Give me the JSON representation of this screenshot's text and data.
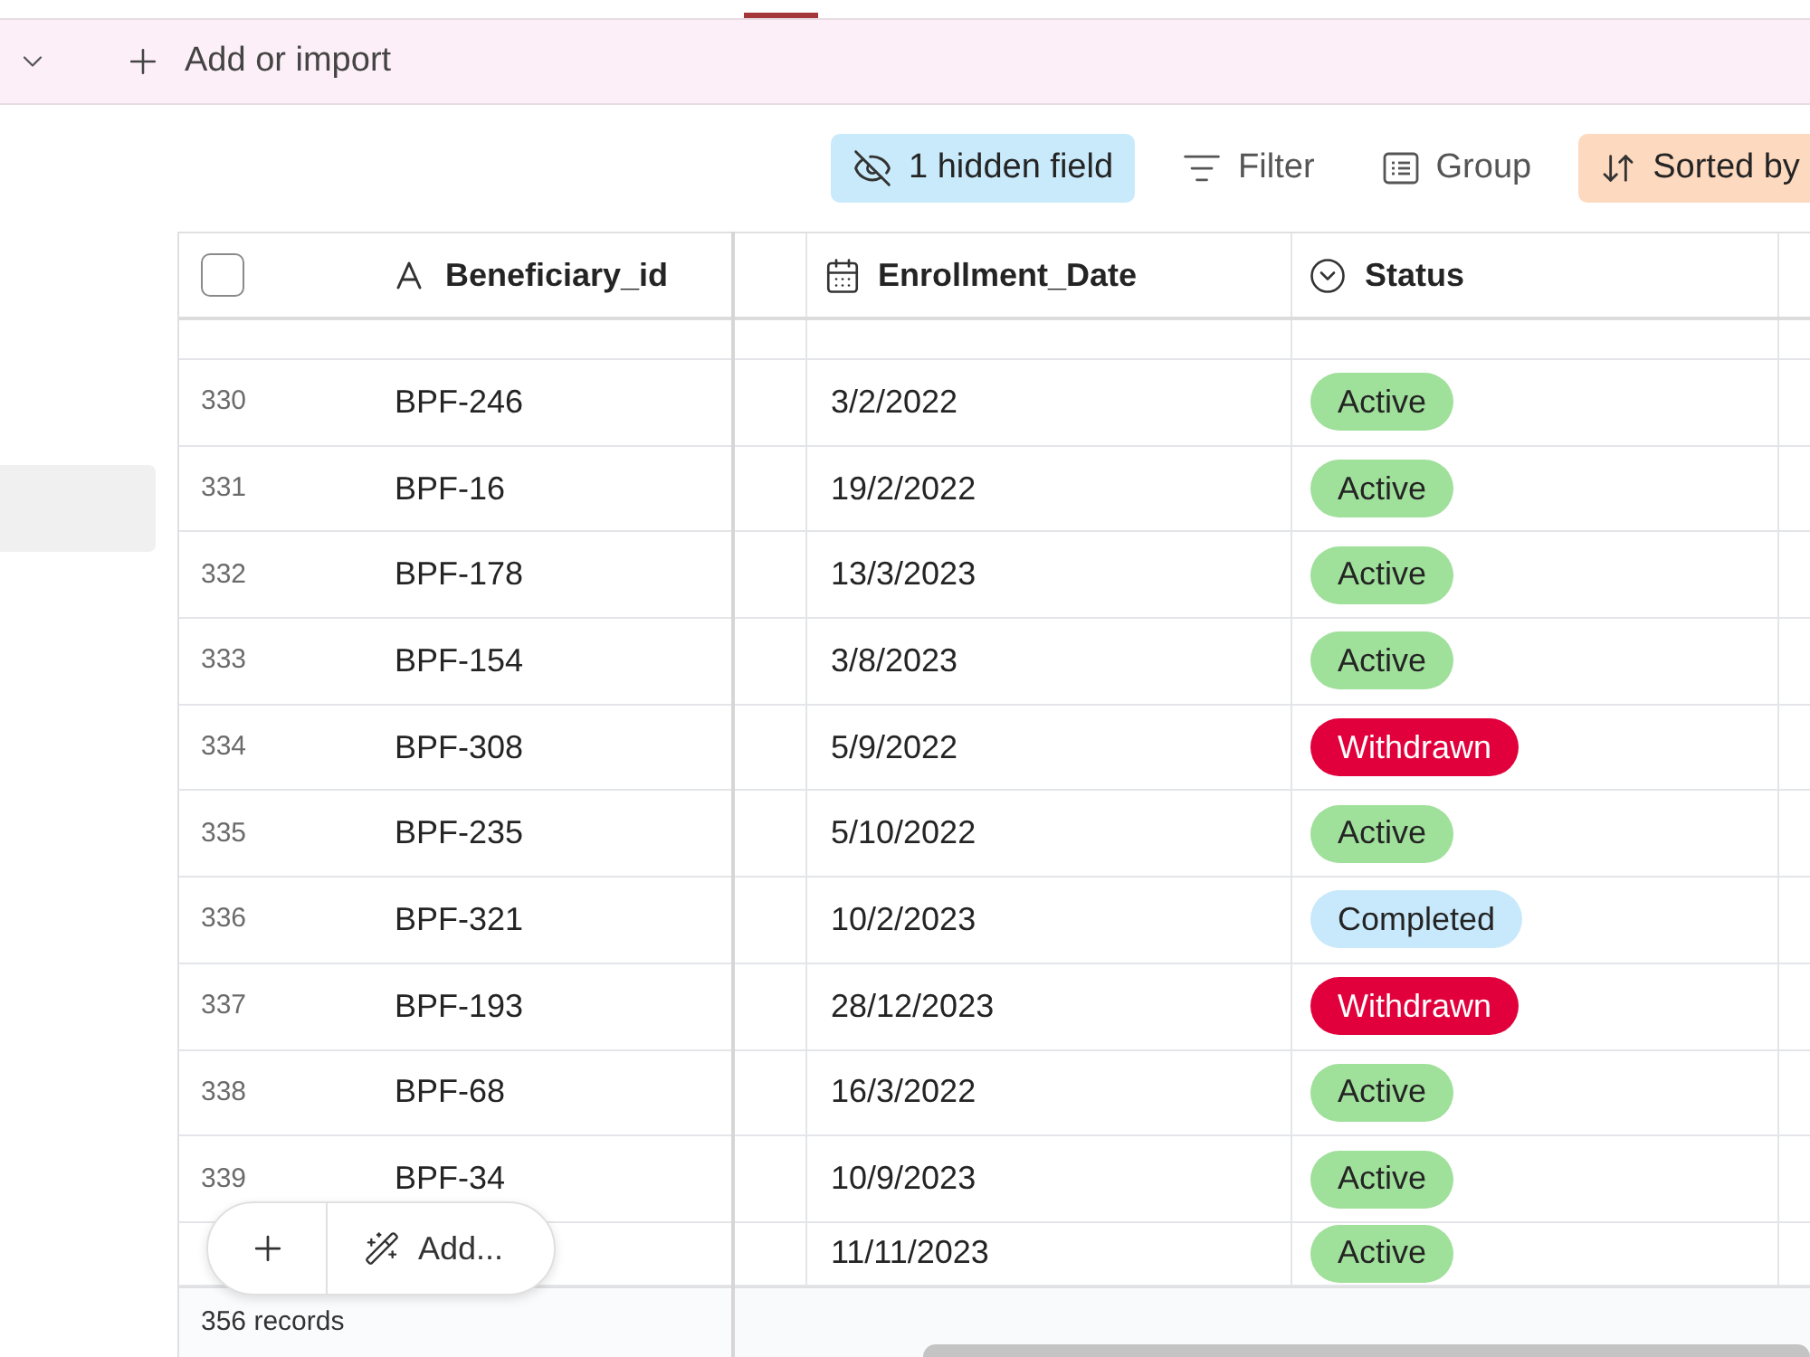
{
  "command_bar": {
    "add_label": "Add or import"
  },
  "toolbar": {
    "buttons": [
      {
        "label": "1 hidden field",
        "kind": "hidden",
        "active": true,
        "color": "#c9eafb"
      },
      {
        "label": "Filter",
        "kind": "filter",
        "active": false
      },
      {
        "label": "Group",
        "kind": "group",
        "active": false
      },
      {
        "label": "Sorted by",
        "kind": "sort",
        "active": true,
        "color": "#fdd9bf"
      }
    ]
  },
  "sidebar": {
    "items": [
      {
        "selected": true
      }
    ]
  },
  "table": {
    "header_checkbox": {
      "checked": false
    },
    "columns": [
      {
        "label": "Beneficiary_id",
        "kind": "text"
      },
      {
        "label": "Enrollment_Date",
        "kind": "date"
      },
      {
        "label": "Status",
        "kind": "choice"
      }
    ],
    "rows": [
      {
        "number": "330",
        "id": "BPF-246",
        "date": "3/2/2022",
        "status": {
          "label": "Active",
          "color": "#9fe09a"
        }
      },
      {
        "number": "331",
        "id": "BPF-16",
        "date": "19/2/2022",
        "status": {
          "label": "Active",
          "color": "#9fe09a"
        }
      },
      {
        "number": "332",
        "id": "BPF-178",
        "date": "13/3/2023",
        "status": {
          "label": "Active",
          "color": "#9fe09a"
        }
      },
      {
        "number": "333",
        "id": "BPF-154",
        "date": "3/8/2023",
        "status": {
          "label": "Active",
          "color": "#9fe09a"
        }
      },
      {
        "number": "334",
        "id": "BPF-308",
        "date": "5/9/2022",
        "status": {
          "label": "Withdrawn",
          "color": "#e1003b"
        }
      },
      {
        "number": "335",
        "id": "BPF-235",
        "date": "5/10/2022",
        "status": {
          "label": "Active",
          "color": "#9fe09a"
        }
      },
      {
        "number": "336",
        "id": "BPF-321",
        "date": "10/2/2023",
        "status": {
          "label": "Completed",
          "color": "#c8e9fb"
        }
      },
      {
        "number": "337",
        "id": "BPF-193",
        "date": "28/12/2023",
        "status": {
          "label": "Withdrawn",
          "color": "#e1003b"
        }
      },
      {
        "number": "338",
        "id": "BPF-68",
        "date": "16/3/2022",
        "status": {
          "label": "Active",
          "color": "#9fe09a"
        }
      },
      {
        "number": "339",
        "id": "BPF-34",
        "date": "10/9/2023",
        "status": {
          "label": "Active",
          "color": "#9fe09a"
        }
      },
      {
        "date": "11/11/2023",
        "status": {
          "label": "Active",
          "color": "#9fe09a"
        }
      }
    ]
  },
  "add_menu": {
    "label": "Add..."
  },
  "footer": {
    "record_count": "356 records"
  }
}
